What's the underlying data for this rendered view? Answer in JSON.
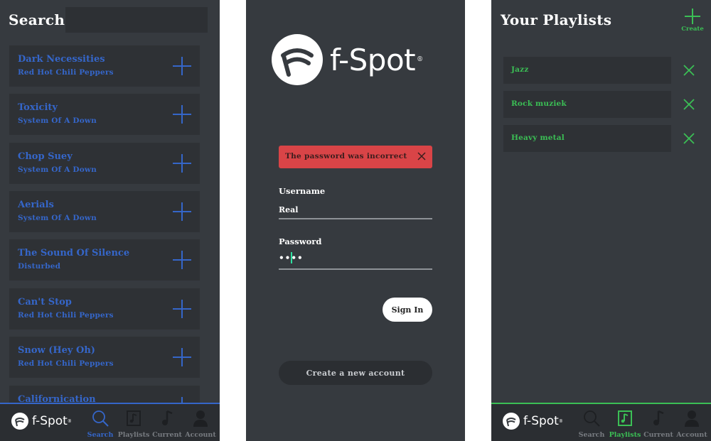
{
  "search_screen": {
    "title": "Search",
    "search_value": "",
    "songs": [
      {
        "title": "Dark Necessities",
        "artist": "Red Hot Chili Peppers"
      },
      {
        "title": "Toxicity",
        "artist": "System Of A Down"
      },
      {
        "title": "Chop Suey",
        "artist": "System Of A Down"
      },
      {
        "title": "Aerials",
        "artist": "System Of A Down"
      },
      {
        "title": "The Sound Of Silence",
        "artist": "Disturbed"
      },
      {
        "title": "Can't Stop",
        "artist": "Red Hot Chili Peppers"
      },
      {
        "title": "Snow (Hey Oh)",
        "artist": "Red Hot Chili Peppers"
      },
      {
        "title": "Californication",
        "artist": ""
      }
    ],
    "accent": "#3566c9"
  },
  "brand": {
    "name": "f-Spot",
    "reg": "®"
  },
  "tabs": {
    "search": "Search",
    "playlists": "Playlists",
    "current": "Current",
    "account": "Account"
  },
  "login_screen": {
    "error": "The password was incorrect",
    "username_label": "Username",
    "username_value": "Real",
    "password_label": "Password",
    "password_value": "••••",
    "sign_in": "Sign In",
    "create_account": "Create a new account",
    "error_color": "#d94447"
  },
  "playlists_screen": {
    "title": "Your Playlists",
    "create_label": "Create",
    "playlists": [
      {
        "name": "Jazz"
      },
      {
        "name": "Rock muziek"
      },
      {
        "name": "Heavy metal"
      }
    ],
    "accent": "#3bbf55"
  }
}
